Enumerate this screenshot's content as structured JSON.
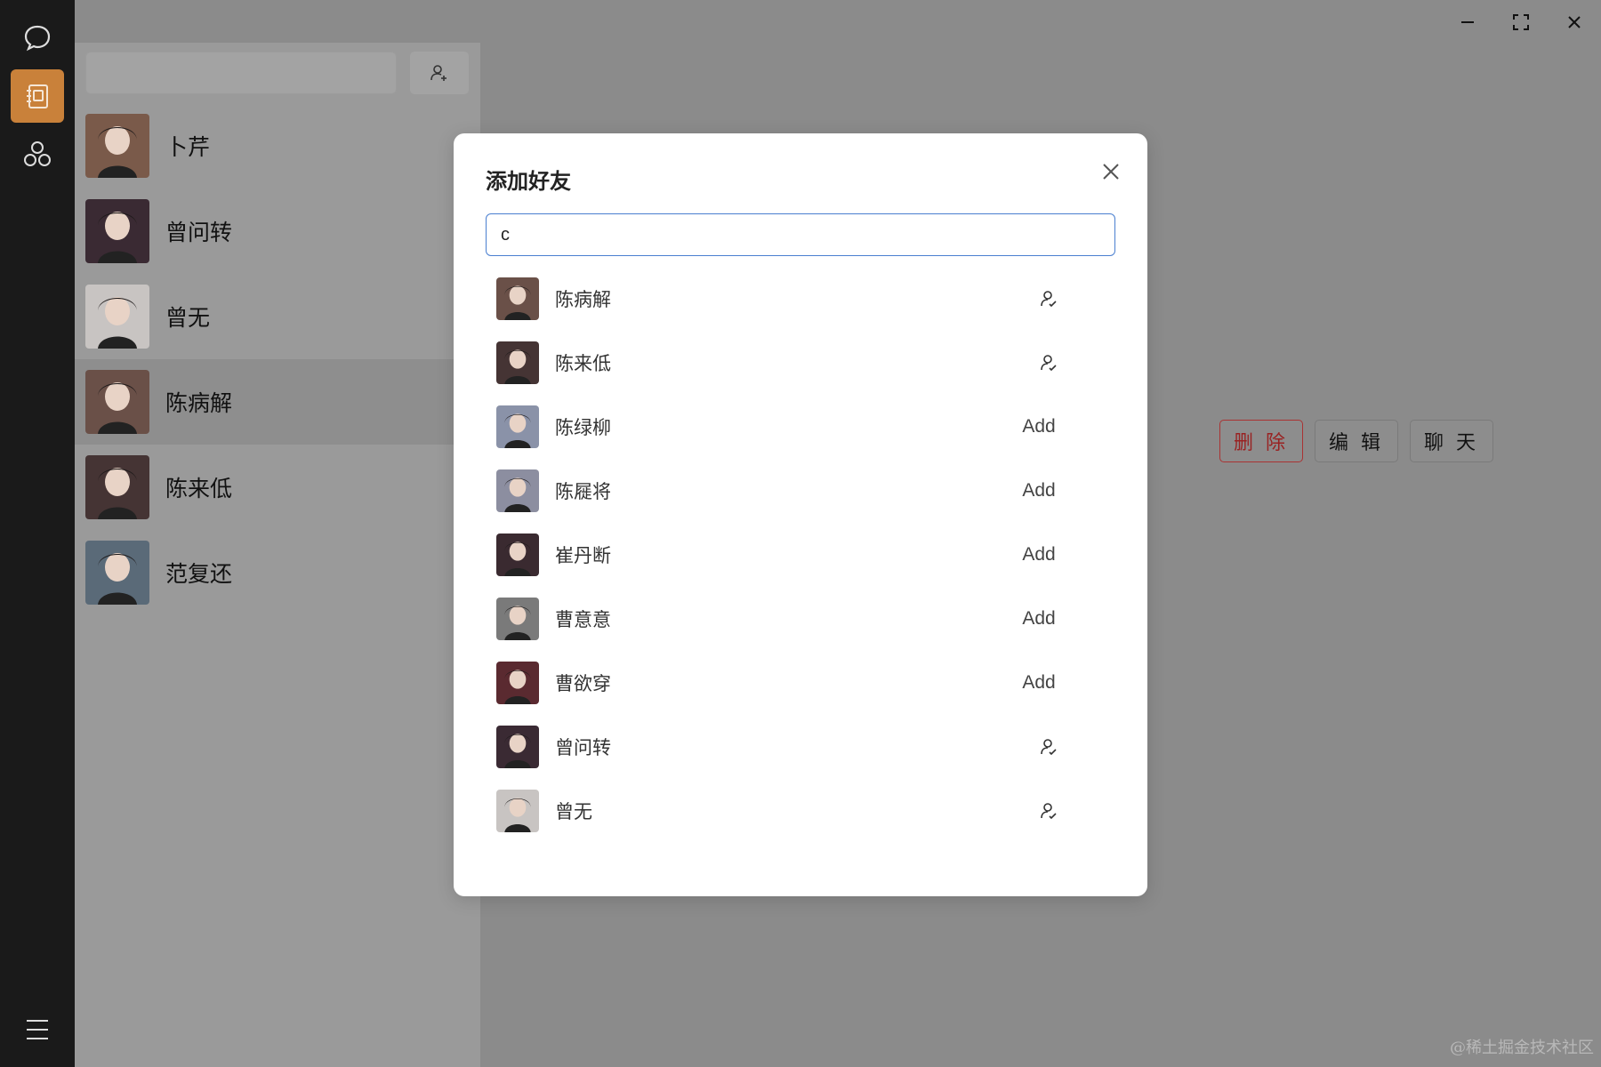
{
  "rail": {
    "items": [
      {
        "icon": "chat-bubble-icon",
        "active": false
      },
      {
        "icon": "contacts-book-icon",
        "active": true
      },
      {
        "icon": "groups-icon",
        "active": false
      }
    ],
    "menu_icon": "hamburger-menu-icon"
  },
  "contacts": [
    {
      "name": "卜芹",
      "avatar_color": "#7a5a4a"
    },
    {
      "name": "曾问转",
      "avatar_color": "#3a2a33"
    },
    {
      "name": "曾无",
      "avatar_color": "#c8c4c2"
    },
    {
      "name": "陈病解",
      "avatar_color": "#6a5048",
      "selected": true
    },
    {
      "name": "陈来低",
      "avatar_color": "#453434"
    },
    {
      "name": "范复还",
      "avatar_color": "#5a6a78"
    }
  ],
  "actions": {
    "delete": "删 除",
    "edit": "编 辑",
    "chat": "聊 天"
  },
  "modal": {
    "title": "添加好友",
    "search_value": "c",
    "results": [
      {
        "name": "陈病解",
        "status": "friend",
        "action": "",
        "avatar_color": "#6a5048"
      },
      {
        "name": "陈来低",
        "status": "friend",
        "action": "",
        "avatar_color": "#453434"
      },
      {
        "name": "陈绿柳",
        "status": "add",
        "action": "Add",
        "avatar_color": "#8a92a8"
      },
      {
        "name": "陈屣将",
        "status": "add",
        "action": "Add",
        "avatar_color": "#8c8ea0"
      },
      {
        "name": "崔丹断",
        "status": "add",
        "action": "Add",
        "avatar_color": "#3a2a30"
      },
      {
        "name": "曹意意",
        "status": "add",
        "action": "Add",
        "avatar_color": "#7a7a7a"
      },
      {
        "name": "曹欲穿",
        "status": "add",
        "action": "Add",
        "avatar_color": "#5a2a30"
      },
      {
        "name": "曾问转",
        "status": "friend",
        "action": "",
        "avatar_color": "#3a2a33"
      },
      {
        "name": "曾无",
        "status": "friend",
        "action": "",
        "avatar_color": "#c8c4c2"
      }
    ]
  },
  "watermark": "@稀土掘金技术社区",
  "colors": {
    "accent": "#c9813a",
    "danger": "#922222",
    "input_border": "#4a7fd0"
  }
}
